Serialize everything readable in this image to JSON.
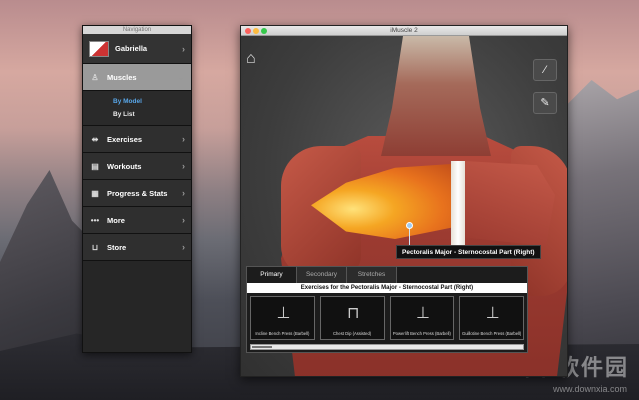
{
  "navigator": {
    "title": "Navigation",
    "user": "Gabriella",
    "items": [
      {
        "label": "Muscles",
        "icon": "figure-icon"
      },
      {
        "label": "Exercises",
        "icon": "dumbbell-icon"
      },
      {
        "label": "Workouts",
        "icon": "workout-icon"
      },
      {
        "label": "Progress & Stats",
        "icon": "calendar-icon"
      },
      {
        "label": "More",
        "icon": "more-dots-icon"
      },
      {
        "label": "Store",
        "icon": "cart-icon"
      }
    ],
    "muscles_sub": [
      "By Model",
      "By List"
    ],
    "selected_sub": "By Model"
  },
  "window": {
    "title": "iMuscle 2",
    "tooltip": "Pectoralis Major - Sternocostal Part (Right)",
    "tabs": [
      "Primary",
      "Secondary",
      "Stretches"
    ],
    "active_tab": "Primary",
    "exercises_header": "Exercises for the Pectoralis Major - Sternocostal Part (Right)",
    "exercises": [
      "Incline Bench Press (Barbell)",
      "Chest Dip (Assisted)",
      "Powerlift Bench Press (Barbell)",
      "Guillotine Bench Press (Barbell)"
    ]
  },
  "watermark": {
    "main": "当下软件园",
    "sub": "www.downxia.com"
  },
  "colors": {
    "selected_sub": "#58a6e8",
    "highlight_muscle": "#f5a623"
  }
}
